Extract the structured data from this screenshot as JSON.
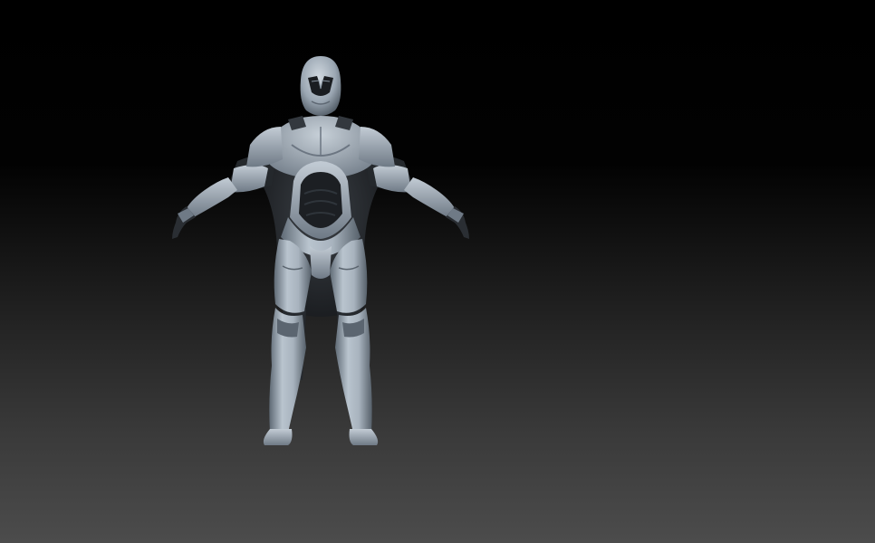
{
  "viewport": {
    "background_top": "#000000",
    "background_bottom": "#4c4c4c"
  },
  "model": {
    "armor_light": "#b7c2cd",
    "armor_mid": "#8793a0",
    "armor_shadow": "#4a535d",
    "suit_dark": "#1f2226",
    "visor": "#111316"
  }
}
